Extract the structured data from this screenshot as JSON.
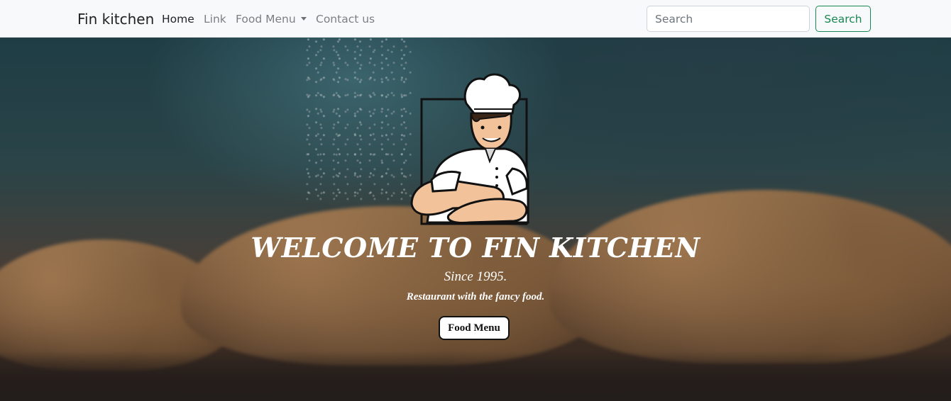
{
  "navbar": {
    "brand": "Fin kitchen",
    "links": [
      {
        "label": "Home",
        "active": true
      },
      {
        "label": "Link",
        "active": false
      },
      {
        "label": "Food Menu",
        "active": false,
        "dropdown": true
      },
      {
        "label": "Contact us",
        "active": false
      }
    ],
    "search_placeholder": "Search",
    "search_button": "Search"
  },
  "hero": {
    "logo_icon": "chef-logo-icon",
    "title": "WELCOME TO FIN KITCHEN",
    "subtitle": "Since 1995.",
    "tagline": "Restaurant with the fancy food.",
    "button_label": "Food Menu"
  },
  "colors": {
    "navbar_bg": "#f8f9fa",
    "accent_green": "#198754"
  }
}
